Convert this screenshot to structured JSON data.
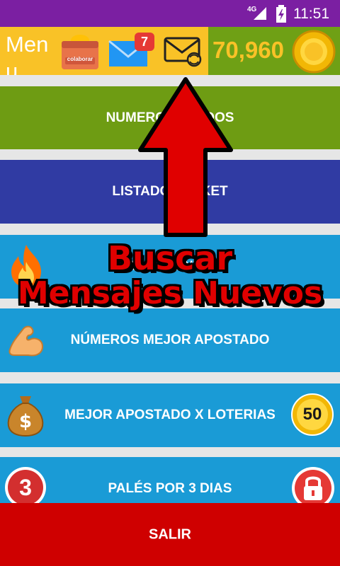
{
  "status_bar": {
    "network": "4G",
    "time": "11:51"
  },
  "header": {
    "menu_label": "Menu",
    "collab_label": "colaborar",
    "mail_badge": "7",
    "coins": "70,960"
  },
  "menu": {
    "item1": "NUMEROS … ADOS",
    "item2": "LISTADO … CKET",
    "item3": "NU… … ENTES",
    "item4": "NÚMEROS MEJOR APOSTADO",
    "item5": "MEJOR APOSTADO X LOTERIAS",
    "item6": "PALÉS POR 3 DIAS",
    "exit": "SALIR"
  },
  "badges": {
    "fifty": "50",
    "three": "3"
  },
  "overlay": {
    "line1": "Buscar",
    "line2": "Mensajes Nuevos"
  },
  "colors": {
    "status_bar": "#7b1fa2",
    "header_yellow": "#f9c227",
    "header_green": "#6fa015",
    "btn_green": "#6e9c13",
    "btn_navy": "#303ba3",
    "btn_blue": "#1a9bd6",
    "btn_exit": "#cf0000",
    "overlay_red": "#e00000"
  },
  "icons": [
    "signal-icon",
    "battery-icon",
    "calendar-icon",
    "mail-icon",
    "mail-refresh-icon",
    "coin-icon",
    "fire-icon",
    "muscle-icon",
    "money-bag-icon",
    "fifty-coin-icon",
    "three-badge-icon",
    "lock-icon",
    "up-arrow-icon"
  ]
}
